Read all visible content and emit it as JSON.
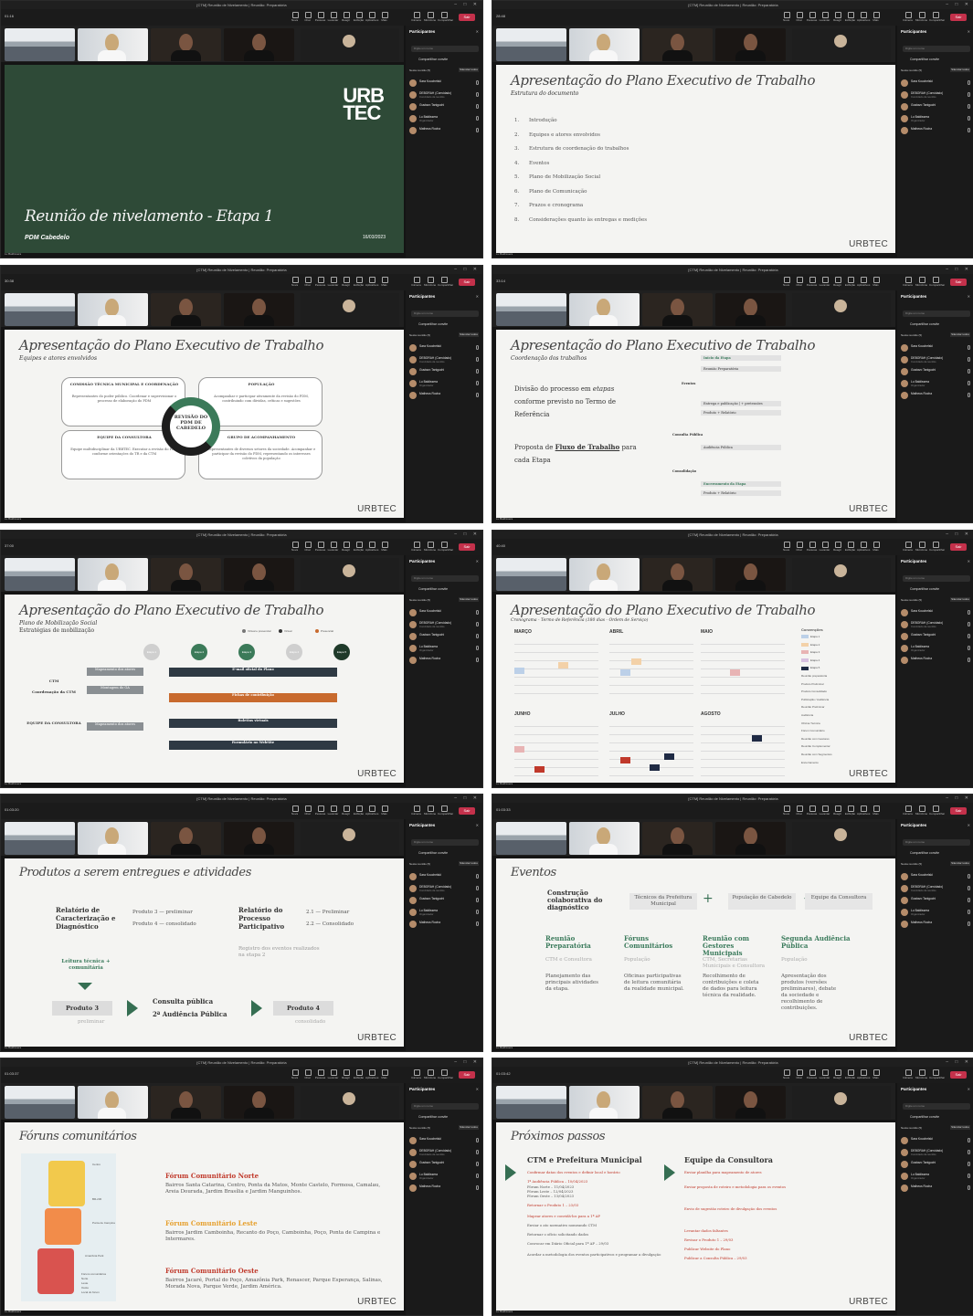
{
  "app": {
    "window_title": "[CTM] Reunião de Nivelamento | Reunião: Preparatória",
    "leave": "Sair",
    "share_invite": "Compartilhar convite",
    "search_placeholder": "Digite um nome",
    "participants_title": "Participantes",
    "in_meeting": "Nesta reunião (5)",
    "mute_all": "Silenciar todos",
    "footer_name": "Lu Baldissera"
  },
  "toolbar_labels": [
    "Nova janela",
    "Chat",
    "Pessoas",
    "Levantar",
    "Reagir",
    "Exibição",
    "Aplicativos",
    "Mais",
    "Câmera",
    "Microfone",
    "Compartilhar"
  ],
  "participants": [
    {
      "name": "Sara Kouchelski",
      "role": ""
    },
    {
      "name": "DEBORAH (Convidado)",
      "role": "Convidado da reunião"
    },
    {
      "name": "Gustavo Taniguchi",
      "role": ""
    },
    {
      "name": "Lu Baldissera",
      "role": "Organizador"
    },
    {
      "name": "Matheus Rocha",
      "role": ""
    }
  ],
  "panels": [
    {
      "timer": "01:16",
      "slide": "cover",
      "logo_1": "URB",
      "logo_2": "TEC",
      "title": "Reunião de nivelamento - Etapa 1",
      "subtitle": "PDM Cabedelo",
      "date": "16/03/2023"
    },
    {
      "timer": "28:48",
      "slide": "agenda",
      "title": "Apresentação do Plano Executivo de Trabalho",
      "subtitle": "Estrutura do documento",
      "items": [
        "Introdução",
        "Equipes e atores envolvidos",
        "Estrutura de coordenação do trabalhos",
        "Eventos",
        "Plano de Mobilização Social",
        "Plano de Comunicação",
        "Prazos e cronograma",
        "Considerações quanto às entregas e medições"
      ],
      "brand": "URBTEC"
    },
    {
      "timer": "30:38",
      "slide": "actors",
      "title": "Apresentação do Plano Executivo de Trabalho",
      "subtitle": "Equipes e atores envolvidos",
      "center": "REVISÃO DO PDM DE CABEDELO",
      "boxes": [
        {
          "title": "COMISSÃO TÉCNICA MUNICIPAL E COORDENAÇÃO",
          "body": "Representantes do poder público. Coordenar e supervisionar o processo de elaboração do PDM"
        },
        {
          "title": "POPULAÇÃO",
          "body": "Acompanhar e participar ativamente da revisão do PDM, contribuindo com dúvidas, críticas e sugestões"
        },
        {
          "title": "EQUIPE DA CONSULTORA",
          "body": "Equipe multidisciplinar da URBTEC. Executar a revisão do PDM conforme orientações do TR e da CTM"
        },
        {
          "title": "GRUPO DE ACOMPANHAMENTO",
          "body": "Representantes de diversos setores da sociedade. Acompanhar e participar da revisão do PDM, representando os interesses coletivos da população"
        }
      ],
      "brand": "URBTEC"
    },
    {
      "timer": "33:14",
      "slide": "coordination",
      "title": "Apresentação do Plano Executivo de Trabalho",
      "subtitle": "Coordenação dos trabalhos",
      "bullet_1_a": "Divisão do processo em",
      "bullet_1_b": "etapas",
      "bullet_1_c": "conforme previsto no Termo de Referência",
      "bullet_2_a": "Proposta de",
      "bullet_2_b": "Fluxo de Trabalho",
      "bullet_2_c": "para cada Etapa",
      "flow": [
        "Início da Etapa",
        "Reunião Preparatória",
        "Entrega e publicação | + pretensões",
        "Produto + Relatório",
        "Audiência Pública",
        "Encerramento da Etapa",
        "Produto + Relatório"
      ],
      "labels": [
        "Eventos",
        "Consulta Pública",
        "Consolidação"
      ],
      "brand": "URBTEC"
    },
    {
      "timer": "37:00",
      "slide": "mobilization",
      "title": "Apresentação do Plano Executivo de Trabalho",
      "subtitle": "Plano de Mobilização Social",
      "subtitle_2": "Estratégias de mobilização",
      "legend": [
        "Virtual e presencial",
        "Virtual",
        "Presencial"
      ],
      "stages": [
        "Etapa 1",
        "Etapa 2",
        "Etapa 3",
        "Etapa 4",
        "Etapa 5"
      ],
      "rows": [
        "CTM",
        "Coordenação da CTM",
        "EQUIPE DA CONSULTORA"
      ],
      "bars": [
        "E-mail oficial do Plano",
        "Fichas de contribuição",
        "Boletins virtuais",
        "Formulário no WebSite"
      ],
      "tags": [
        "Mapeamento dos atores",
        "Montagem do GA",
        "Mapeamento dos atores"
      ],
      "brand": "URBTEC"
    },
    {
      "timer": "40:40",
      "slide": "schedule",
      "title": "Apresentação do Plano Executivo de Trabalho",
      "subtitle": "Cronograma - Termo de Referência (180 dias - Ordem de Serviço)",
      "months": [
        "MARÇO",
        "ABRIL",
        "MAIO",
        "JUNHO",
        "JULHO",
        "AGOSTO"
      ],
      "legend_title": "Convenções",
      "legend": [
        "Etapa 1",
        "Etapa 2",
        "Etapa 3",
        "Etapa 4",
        "Etapa 5",
        "Reunião preparatória",
        "Produto Preliminar",
        "Produto Consolidado",
        "Publicação / Audiência",
        "Reunião Preliminar",
        "Audiência",
        "Oficina Técnica",
        "Fórum Comunitário",
        "Reunião com Gestores",
        "Reunião Complementar",
        "Reunião com Segmentos",
        "Encerramento"
      ],
      "brand": "URBTEC"
    },
    {
      "timer": "01:03:20",
      "slide": "products",
      "title": "Produtos a serem entregues e atividades",
      "left_title": "Relatório de Caracterização e Diagnóstico",
      "left_items": [
        "Produto 3 — preliminar",
        "Produto 4 — consolidado"
      ],
      "right_title": "Relatório do Processo Participativo",
      "right_items": [
        "2.1 — Preliminar",
        "2.2 — Consolidado"
      ],
      "right_note": "Registro dos eventos realizados na etapa 2",
      "reading": "Leitura técnica + comunitária",
      "p3": "Produto 3",
      "p3_sub": "preliminar",
      "mid": "Consulta pública",
      "mid_2": "2ª Audiência Pública",
      "p4": "Produto 4",
      "p4_sub": "consolidado",
      "brand": "URBTEC"
    },
    {
      "timer": "01:03:33",
      "slide": "events",
      "title": "Eventos",
      "collab": "Construção colaborativa do diagnóstico",
      "g1": "Técnicos da Prefeitura Municipal",
      "g2": "População de Cabedelo",
      "g3": "Equipe da Consultora",
      "cols": [
        {
          "t": "Reunião Preparatória",
          "s": "CTM e Consultora",
          "d": "Planejamento das principais atividades da etapa."
        },
        {
          "t": "Fóruns Comunitários",
          "s": "População",
          "d": "Oficinas participativas de leitura comunitária da realidade municipal."
        },
        {
          "t": "Reunião com Gestores Municipais",
          "s": "CTM, Secretarias Municipais e Consultora",
          "d": "Recolhimento de contribuições e coleta de dados para leitura técnica da realidade."
        },
        {
          "t": "Segunda Audiência Pública",
          "s": "População",
          "d": "Apresentação dos produtos (versões preliminares), debate da sociedade e recolhimento de contribuições."
        }
      ],
      "brand": "URBTEC"
    },
    {
      "timer": "01:03:37",
      "slide": "forums",
      "title": "Fóruns comunitários",
      "forums": [
        {
          "t": "Fórum Comunitário Norte",
          "d": "Bairros Santa Catarina, Centro, Ponta da Matos, Monte Castelo, Formosa, Camalau, Areia Dourada, Jardim Brasília e Jardim Manguinhos."
        },
        {
          "t": "Fórum Comunitário Leste",
          "d": "Bairros Jardim Camboinha, Recanto do Poço, Camboinha, Poço, Ponta de Campina e Intermares."
        },
        {
          "t": "Fórum Comunitário Oeste",
          "d": "Bairros Jacaré, Portal do Poço, Amazônia Park, Renascer, Parque Esperança, Salinas, Morada Nova, Parque Verde, Jardim América."
        }
      ],
      "map_labels": [
        "Centro",
        "BR-230",
        "Ponta de Campina",
        "Amazônia Park"
      ],
      "map_legend": [
        "Fóruns comunitários",
        "Norte",
        "Leste",
        "Oeste",
        "Local do fórum"
      ],
      "brand": "URBTEC"
    },
    {
      "timer": "01:03:42",
      "slide": "nextsteps",
      "title": "Próximos passos",
      "left_title": "CTM e Prefeitura Municipal",
      "left_items": [
        "Confirmar datas dos eventos e definir local e horário",
        "1ª Audiência Pública – 10/04/2023",
        "Fórum Norte – 11/04/2023",
        "Fórum Leste – 12/04/2023",
        "Fórum Oeste – 13/04/2023",
        "Retornar o Produto 1 – 23/03",
        "Mapear atores e convidá-los para a 1ª AP",
        "Enviar o ato normativo nomeando CTM",
        "Retornar o ofício solicitando dados",
        "Convocar em Diário Oficial para 1ª AP – 29/03",
        "Acordar a metodologia dos eventos participativos e programar a divulgação"
      ],
      "right_title": "Equipe da Consultora",
      "right_items": [
        "Enviar planilha para mapeamento de atores",
        "Enviar proposta de roteiro e metodologia para os eventos",
        "Envio de sugestão roteiro de divulgação dos eventos",
        "Levantar dados faltantes",
        "Revisar o Produto 1 – 29/03",
        "Publicar Website do Plano",
        "Publicar a Consulta Pública – 29/03"
      ],
      "brand": "URBTEC"
    }
  ]
}
